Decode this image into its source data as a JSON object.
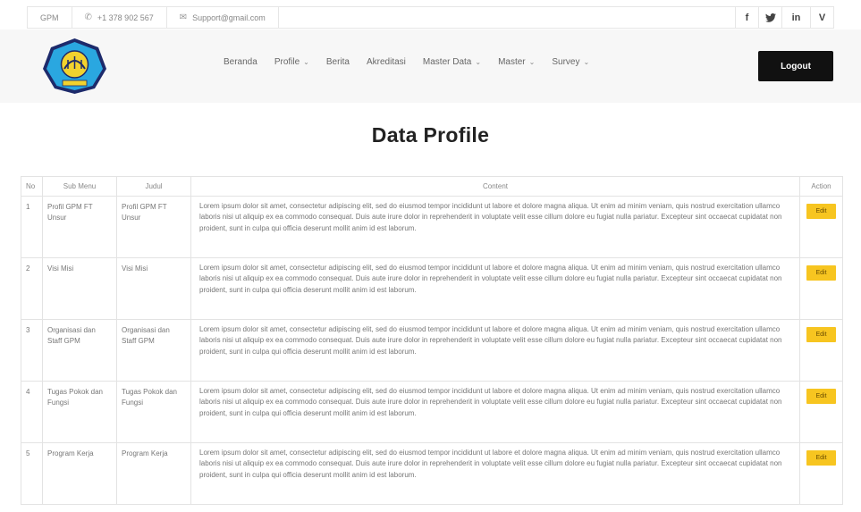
{
  "topbar": {
    "brand": "GPM",
    "phone": "+1 378 902 567",
    "email": "Support@gmail.com",
    "social": [
      {
        "icon": "facebook-icon",
        "glyph": "f"
      },
      {
        "icon": "twitter-icon",
        "glyph": "🐦"
      },
      {
        "icon": "linkedin-icon",
        "glyph": "in"
      },
      {
        "icon": "vimeo-icon",
        "glyph": "V"
      }
    ]
  },
  "header": {
    "nav": [
      {
        "label": "Beranda",
        "dropdown": false
      },
      {
        "label": "Profile",
        "dropdown": true
      },
      {
        "label": "Berita",
        "dropdown": false
      },
      {
        "label": "Akreditasi",
        "dropdown": false
      },
      {
        "label": "Master Data",
        "dropdown": true
      },
      {
        "label": "Master",
        "dropdown": true
      },
      {
        "label": "Survey",
        "dropdown": true
      }
    ],
    "logout_label": "Logout"
  },
  "page": {
    "title": "Data Profile"
  },
  "table": {
    "headers": {
      "no": "No",
      "sub_menu": "Sub Menu",
      "judul": "Judul",
      "content": "Content",
      "action": "Action"
    },
    "action_label": "Edit",
    "rows": [
      {
        "no": "1",
        "sub_menu": "Profil GPM FT Unsur",
        "judul": "Profil GPM FT Unsur",
        "content": "Lorem ipsum dolor sit amet, consectetur adipiscing elit, sed do eiusmod tempor incididunt ut labore et dolore magna aliqua. Ut enim ad minim veniam, quis nostrud exercitation ullamco laboris nisi ut aliquip ex ea commodo consequat. Duis aute irure dolor in reprehenderit in voluptate velit esse cillum dolore eu fugiat nulla pariatur. Excepteur sint occaecat cupidatat non proident, sunt in culpa qui officia deserunt mollit anim id est laborum."
      },
      {
        "no": "2",
        "sub_menu": "Visi Misi",
        "judul": "Visi Misi",
        "content": "Lorem ipsum dolor sit amet, consectetur adipiscing elit, sed do eiusmod tempor incididunt ut labore et dolore magna aliqua. Ut enim ad minim veniam, quis nostrud exercitation ullamco laboris nisi ut aliquip ex ea commodo consequat. Duis aute irure dolor in reprehenderit in voluptate velit esse cillum dolore eu fugiat nulla pariatur. Excepteur sint occaecat cupidatat non proident, sunt in culpa qui officia deserunt mollit anim id est laborum."
      },
      {
        "no": "3",
        "sub_menu": "Organisasi dan Staff GPM",
        "judul": "Organisasi dan Staff GPM",
        "content": "Lorem ipsum dolor sit amet, consectetur adipiscing elit, sed do eiusmod tempor incididunt ut labore et dolore magna aliqua. Ut enim ad minim veniam, quis nostrud exercitation ullamco laboris nisi ut aliquip ex ea commodo consequat. Duis aute irure dolor in reprehenderit in voluptate velit esse cillum dolore eu fugiat nulla pariatur. Excepteur sint occaecat cupidatat non proident, sunt in culpa qui officia deserunt mollit anim id est laborum."
      },
      {
        "no": "4",
        "sub_menu": "Tugas Pokok dan Fungsi",
        "judul": "Tugas Pokok dan Fungsi",
        "content": "Lorem ipsum dolor sit amet, consectetur adipiscing elit, sed do eiusmod tempor incididunt ut labore et dolore magna aliqua. Ut enim ad minim veniam, quis nostrud exercitation ullamco laboris nisi ut aliquip ex ea commodo consequat. Duis aute irure dolor in reprehenderit in voluptate velit esse cillum dolore eu fugiat nulla pariatur. Excepteur sint occaecat cupidatat non proident, sunt in culpa qui officia deserunt mollit anim id est laborum."
      },
      {
        "no": "5",
        "sub_menu": "Program Kerja",
        "judul": "Program Kerja",
        "content": "Lorem ipsum dolor sit amet, consectetur adipiscing elit, sed do eiusmod tempor incididunt ut labore et dolore magna aliqua. Ut enim ad minim veniam, quis nostrud exercitation ullamco laboris nisi ut aliquip ex ea commodo consequat. Duis aute irure dolor in reprehenderit in voluptate velit esse cillum dolore eu fugiat nulla pariatur. Excepteur sint occaecat cupidatat non proident, sunt in culpa qui officia deserunt mollit anim id est laborum."
      }
    ]
  }
}
